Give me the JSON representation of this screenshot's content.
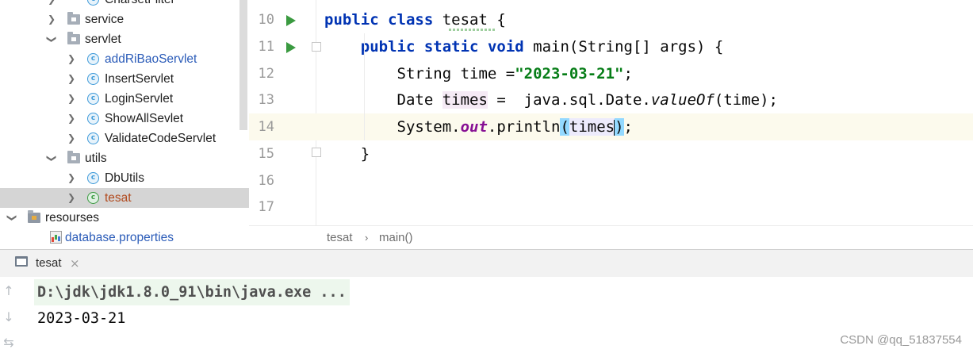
{
  "project_tree": {
    "items": [
      {
        "label": "CharsetFilter",
        "icon": "class-icon",
        "expanded": false
      },
      {
        "label": "service",
        "icon": "package-folder-icon",
        "expanded": false
      },
      {
        "label": "servlet",
        "icon": "package-folder-icon",
        "expanded": true
      },
      {
        "label": "addRiBaoServlet",
        "icon": "class-icon",
        "expanded": false
      },
      {
        "label": "InsertServlet",
        "icon": "class-icon",
        "expanded": false
      },
      {
        "label": "LoginServlet",
        "icon": "class-icon",
        "expanded": false
      },
      {
        "label": "ShowAllSevlet",
        "icon": "class-icon",
        "expanded": false
      },
      {
        "label": "ValidateCodeServlet",
        "icon": "class-icon",
        "expanded": false
      },
      {
        "label": "utils",
        "icon": "package-folder-icon",
        "expanded": true
      },
      {
        "label": "DbUtils",
        "icon": "class-icon",
        "expanded": false
      },
      {
        "label": "tesat",
        "icon": "runnable-class-icon",
        "expanded": false,
        "selected": true
      },
      {
        "label": "resourses",
        "icon": "resources-folder-icon",
        "expanded": true
      },
      {
        "label": "database.properties",
        "icon": "properties-file-icon"
      }
    ],
    "colors": {
      "modified": "#2a5bb8",
      "selected_text": "#b14a1e",
      "default": "#1f1f1f"
    }
  },
  "editor": {
    "lines": [
      {
        "number": "10",
        "tokens": [
          [
            "kw",
            "public"
          ],
          [
            "p",
            " "
          ],
          [
            "kw",
            "class"
          ],
          [
            "p",
            " tesat {"
          ]
        ]
      },
      {
        "number": "11",
        "tokens": [
          [
            "p",
            "    "
          ],
          [
            "kw",
            "public"
          ],
          [
            "p",
            " "
          ],
          [
            "kw",
            "static"
          ],
          [
            "p",
            " "
          ],
          [
            "kw",
            "void"
          ],
          [
            "p",
            " main(String[] args) {"
          ]
        ]
      },
      {
        "number": "12",
        "tokens": [
          [
            "p",
            "        String time ="
          ],
          [
            "str",
            "\"2023-03-21\""
          ],
          [
            "p",
            ";"
          ]
        ]
      },
      {
        "number": "13",
        "tokens": [
          [
            "p",
            "        Date "
          ],
          [
            "hl",
            "times"
          ],
          [
            "p",
            " =  java.sql.Date."
          ],
          [
            "it",
            "valueOf"
          ],
          [
            "p",
            "(time);"
          ]
        ]
      },
      {
        "number": "14",
        "tokens": [
          [
            "p",
            "        System."
          ],
          [
            "static",
            "out"
          ],
          [
            "p",
            ".println"
          ],
          [
            "bh",
            "("
          ],
          [
            "ih",
            "times"
          ],
          [
            "caret",
            ""
          ],
          [
            "bh",
            ")"
          ],
          [
            "p",
            ";"
          ]
        ]
      },
      {
        "number": "15",
        "tokens": [
          [
            "p",
            "    }"
          ]
        ]
      },
      {
        "number": "16",
        "tokens": []
      },
      {
        "number": "17",
        "tokens": []
      }
    ],
    "colors": {
      "keyword": "#0033b3",
      "string": "#067d17",
      "static_field": "#871094",
      "run_icon": "#3a9a40",
      "current_line": "#fcfaed"
    }
  },
  "breadcrumb": {
    "items": [
      "tesat",
      "main()"
    ],
    "separator": "›"
  },
  "run_panel": {
    "tab_label": "tesat",
    "close_glyph": "×",
    "side_tools": [
      "↑",
      "↓",
      "⇆"
    ],
    "output": [
      {
        "text": "D:\\jdk\\jdk1.8.0_91\\bin\\java.exe ...",
        "kind": "command"
      },
      {
        "text": "2023-03-21",
        "kind": "output"
      }
    ]
  },
  "watermark": "CSDN @qq_51837554"
}
